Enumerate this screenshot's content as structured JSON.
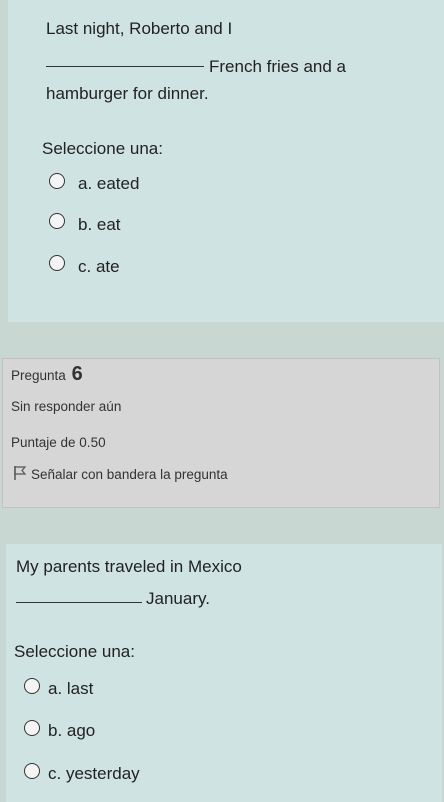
{
  "question5": {
    "line1": "Last night, Roberto and I",
    "line2": "French fries and a",
    "line3": "hamburger for dinner.",
    "select_prompt": "Seleccione una:",
    "options": [
      "a. eated",
      "b. eat",
      "c. ate"
    ]
  },
  "question6_info": {
    "label": "Pregunta",
    "number": "6",
    "status": "Sin responder aún",
    "score": "Puntaje de 0.50",
    "flag_label": "Señalar con bandera la pregunta"
  },
  "question7": {
    "line1": "My parents traveled in Mexico",
    "line2": "January.",
    "select_prompt": "Seleccione una:",
    "options": [
      "a. last",
      "b. ago",
      "c. yesterday"
    ]
  }
}
